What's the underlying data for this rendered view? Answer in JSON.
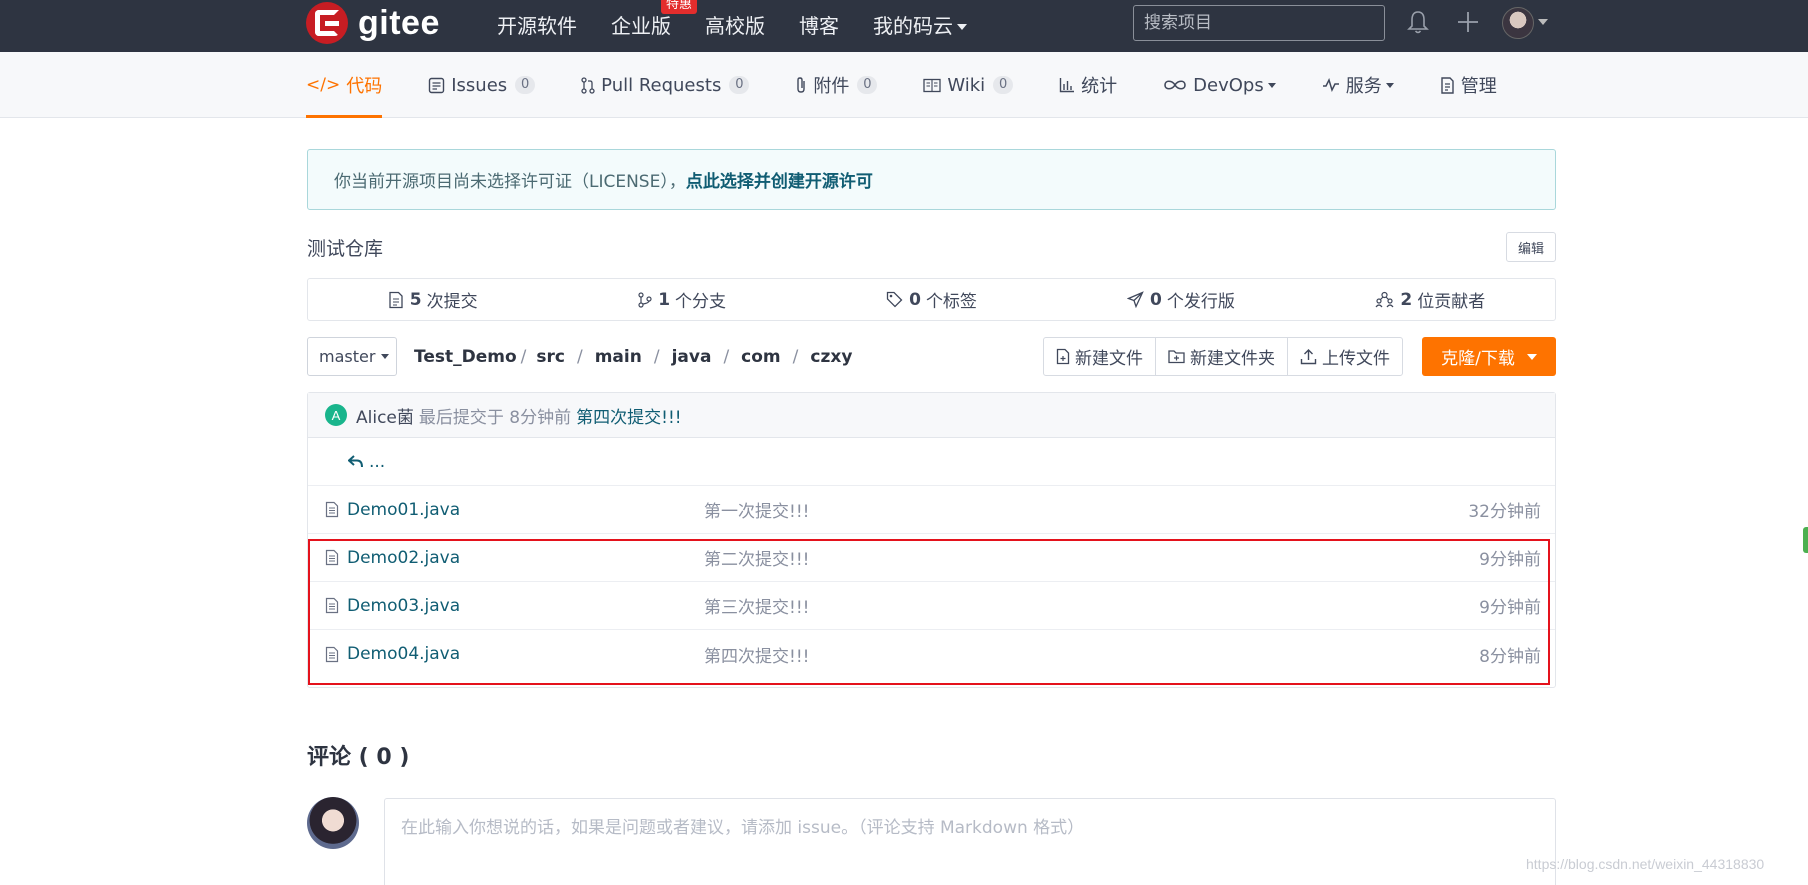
{
  "nav": {
    "logo_text": "gitee",
    "links": [
      "开源软件",
      "企业版",
      "高校版",
      "博客",
      "我的码云"
    ],
    "hot_badge": "特惠",
    "search_placeholder": "搜索项目"
  },
  "tabs": [
    {
      "label": "代码",
      "icon": "code-icon",
      "count": null
    },
    {
      "label": "Issues",
      "icon": "issues-icon",
      "count": "0"
    },
    {
      "label": "Pull Requests",
      "icon": "pull-request-icon",
      "count": "0"
    },
    {
      "label": "附件",
      "icon": "attachment-icon",
      "count": "0"
    },
    {
      "label": "Wiki",
      "icon": "wiki-icon",
      "count": "0"
    },
    {
      "label": "统计",
      "icon": "stats-icon",
      "count": null
    },
    {
      "label": "DevOps",
      "icon": "devops-icon",
      "count": null
    },
    {
      "label": "服务",
      "icon": "service-icon",
      "count": null
    },
    {
      "label": "管理",
      "icon": "manage-icon",
      "count": null
    }
  ],
  "notice": {
    "text": "你当前开源项目尚未选择许可证（LICENSE），",
    "link": "点此选择并创建开源许可"
  },
  "repo": {
    "description": "测试仓库",
    "edit_label": "编辑"
  },
  "stats": [
    {
      "num": "5",
      "label": "次提交"
    },
    {
      "num": "1",
      "label": "个分支"
    },
    {
      "num": "0",
      "label": "个标签"
    },
    {
      "num": "0",
      "label": "个发行版"
    },
    {
      "num": "2",
      "label": "位贡献者"
    }
  ],
  "toolbar": {
    "branch": "master",
    "path": [
      "Test_Demo",
      "src",
      "main",
      "java",
      "com",
      "czxy"
    ],
    "new_file": "新建文件",
    "new_folder": "新建文件夹",
    "upload": "上传文件",
    "clone": "克隆/下载"
  },
  "commit": {
    "avatar_letter": "A",
    "author": "Alice菌",
    "meta": "最后提交于 8分钟前",
    "message": "第四次提交!!!"
  },
  "up_dir": "...",
  "files": [
    {
      "name": "Demo01.java",
      "message": "第一次提交!!!",
      "time": "32分钟前"
    },
    {
      "name": "Demo02.java",
      "message": "第二次提交!!!",
      "time": "9分钟前"
    },
    {
      "name": "Demo03.java",
      "message": "第三次提交!!!",
      "time": "9分钟前"
    },
    {
      "name": "Demo04.java",
      "message": "第四次提交!!!",
      "time": "8分钟前"
    }
  ],
  "comments": {
    "title": "评论 ( 0 )",
    "placeholder": "在此输入你想说的话，如果是问题或者建议，请添加 issue。（评论支持 Markdown 格式）"
  },
  "watermark": "https://blog.csdn.net/weixin_44318830",
  "colors": {
    "accent": "#fe7300",
    "nav_bg": "#2e3441",
    "link": "#105d73",
    "highlight": "#e4121c"
  }
}
